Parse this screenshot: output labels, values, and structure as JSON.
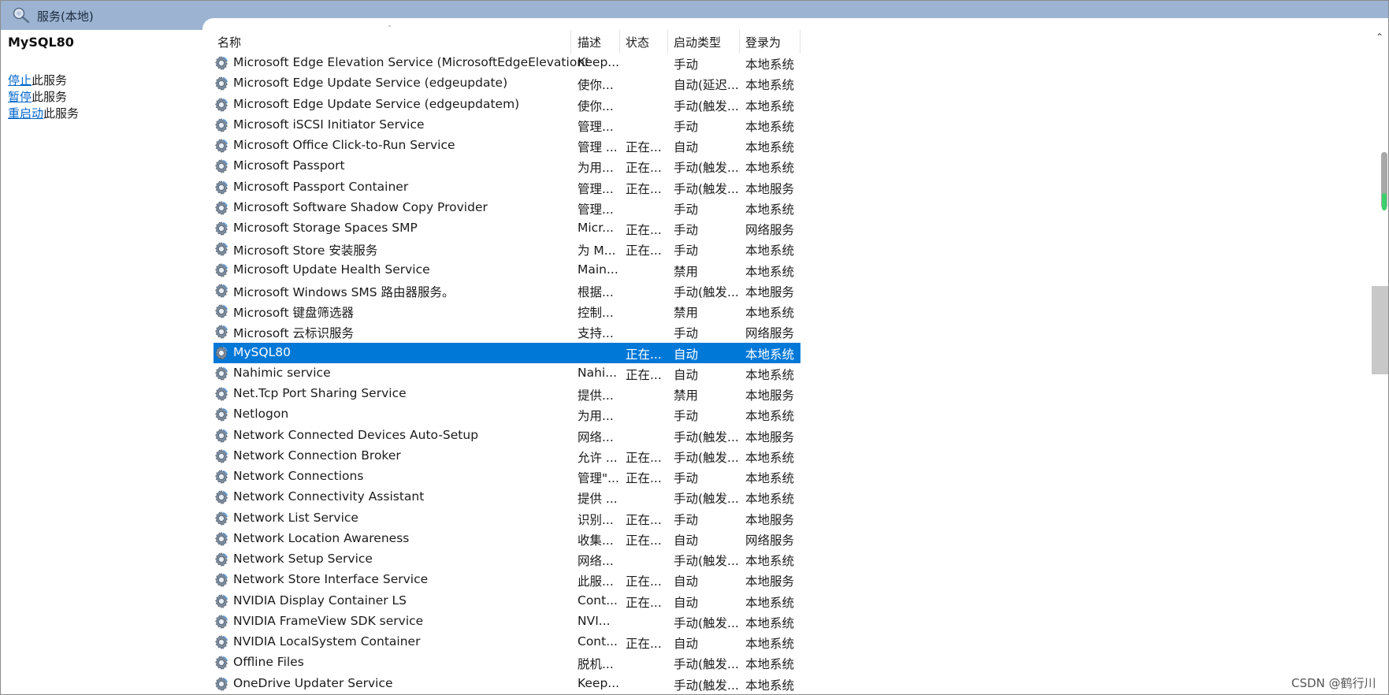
{
  "window": {
    "title": "服务(本地)"
  },
  "left_panel": {
    "service_name": "MySQL80",
    "actions": [
      {
        "link": "停止",
        "text": "此服务"
      },
      {
        "link": "暂停",
        "text": "此服务"
      },
      {
        "link": "重启动",
        "text": "此服务"
      }
    ]
  },
  "table": {
    "columns": [
      "名称",
      "描述",
      "状态",
      "启动类型",
      "登录为"
    ],
    "selected_index": 14,
    "rows": [
      {
        "name": "Microsoft Edge Elevation Service (MicrosoftEdgeElevationSer...",
        "desc": "Keep...",
        "state": "",
        "start": "手动",
        "logon": "本地系统"
      },
      {
        "name": "Microsoft Edge Update Service (edgeupdate)",
        "desc": "使你...",
        "state": "",
        "start": "自动(延迟...",
        "logon": "本地系统"
      },
      {
        "name": "Microsoft Edge Update Service (edgeupdatem)",
        "desc": "使你...",
        "state": "",
        "start": "手动(触发...",
        "logon": "本地系统"
      },
      {
        "name": "Microsoft iSCSI Initiator Service",
        "desc": "管理...",
        "state": "",
        "start": "手动",
        "logon": "本地系统"
      },
      {
        "name": "Microsoft Office Click-to-Run Service",
        "desc": "管理 ...",
        "state": "正在...",
        "start": "自动",
        "logon": "本地系统"
      },
      {
        "name": "Microsoft Passport",
        "desc": "为用...",
        "state": "正在...",
        "start": "手动(触发...",
        "logon": "本地系统"
      },
      {
        "name": "Microsoft Passport Container",
        "desc": "管理...",
        "state": "正在...",
        "start": "手动(触发...",
        "logon": "本地服务"
      },
      {
        "name": "Microsoft Software Shadow Copy Provider",
        "desc": "管理...",
        "state": "",
        "start": "手动",
        "logon": "本地系统"
      },
      {
        "name": "Microsoft Storage Spaces SMP",
        "desc": "Micr...",
        "state": "正在...",
        "start": "手动",
        "logon": "网络服务"
      },
      {
        "name": "Microsoft Store 安装服务",
        "desc": "为 M...",
        "state": "正在...",
        "start": "手动",
        "logon": "本地系统"
      },
      {
        "name": "Microsoft Update Health Service",
        "desc": "Main...",
        "state": "",
        "start": "禁用",
        "logon": "本地系统"
      },
      {
        "name": "Microsoft Windows SMS 路由器服务。",
        "desc": "根据...",
        "state": "",
        "start": "手动(触发...",
        "logon": "本地服务"
      },
      {
        "name": "Microsoft 键盘筛选器",
        "desc": "控制...",
        "state": "",
        "start": "禁用",
        "logon": "本地系统"
      },
      {
        "name": "Microsoft 云标识服务",
        "desc": "支持...",
        "state": "",
        "start": "手动",
        "logon": "网络服务"
      },
      {
        "name": "MySQL80",
        "desc": "",
        "state": "正在...",
        "start": "自动",
        "logon": "本地系统"
      },
      {
        "name": "Nahimic service",
        "desc": "Nahi...",
        "state": "正在...",
        "start": "自动",
        "logon": "本地系统"
      },
      {
        "name": "Net.Tcp Port Sharing Service",
        "desc": "提供...",
        "state": "",
        "start": "禁用",
        "logon": "本地服务"
      },
      {
        "name": "Netlogon",
        "desc": "为用...",
        "state": "",
        "start": "手动",
        "logon": "本地系统"
      },
      {
        "name": "Network Connected Devices Auto-Setup",
        "desc": "网络...",
        "state": "",
        "start": "手动(触发...",
        "logon": "本地服务"
      },
      {
        "name": "Network Connection Broker",
        "desc": "允许 ...",
        "state": "正在...",
        "start": "手动(触发...",
        "logon": "本地系统"
      },
      {
        "name": "Network Connections",
        "desc": "管理\"...",
        "state": "正在...",
        "start": "手动",
        "logon": "本地系统"
      },
      {
        "name": "Network Connectivity Assistant",
        "desc": "提供 ...",
        "state": "",
        "start": "手动(触发...",
        "logon": "本地系统"
      },
      {
        "name": "Network List Service",
        "desc": "识别...",
        "state": "正在...",
        "start": "手动",
        "logon": "本地服务"
      },
      {
        "name": "Network Location Awareness",
        "desc": "收集...",
        "state": "正在...",
        "start": "自动",
        "logon": "网络服务"
      },
      {
        "name": "Network Setup Service",
        "desc": "网络...",
        "state": "",
        "start": "手动(触发...",
        "logon": "本地系统"
      },
      {
        "name": "Network Store Interface Service",
        "desc": "此服...",
        "state": "正在...",
        "start": "自动",
        "logon": "本地服务"
      },
      {
        "name": "NVIDIA Display Container LS",
        "desc": "Cont...",
        "state": "正在...",
        "start": "自动",
        "logon": "本地系统"
      },
      {
        "name": "NVIDIA FrameView SDK service",
        "desc": "NVI...",
        "state": "",
        "start": "手动(触发...",
        "logon": "本地系统"
      },
      {
        "name": "NVIDIA LocalSystem Container",
        "desc": "Cont...",
        "state": "正在...",
        "start": "自动",
        "logon": "本地系统"
      },
      {
        "name": "Offline Files",
        "desc": "脱机...",
        "state": "",
        "start": "手动(触发...",
        "logon": "本地系统"
      },
      {
        "name": "OneDrive Updater Service",
        "desc": "Keep...",
        "state": "",
        "start": "手动(触发...",
        "logon": "本地系统"
      }
    ]
  },
  "watermark": "CSDN @鹤行川"
}
